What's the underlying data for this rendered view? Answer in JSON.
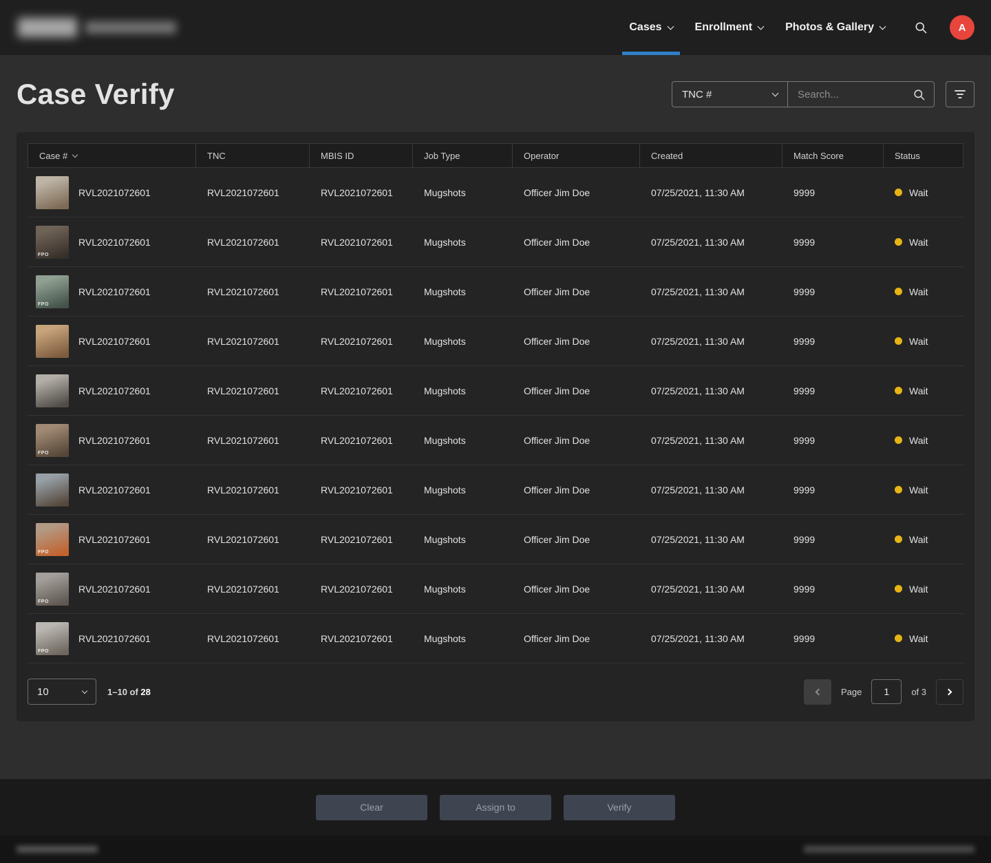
{
  "colors": {
    "accent": "#2f80c9",
    "avatar": "#e8453c",
    "status_wait": "#e7b416"
  },
  "nav": {
    "items": [
      "Cases",
      "Enrollment",
      "Photos & Gallery"
    ],
    "active_item": "Cases",
    "avatar_initial": "A"
  },
  "page": {
    "title": "Case Verify"
  },
  "filters": {
    "category": "TNC #",
    "search_placeholder": "Search..."
  },
  "table": {
    "columns": [
      "Case #",
      "TNC",
      "MBIS ID",
      "Job Type",
      "Operator",
      "Created",
      "Match Score",
      "Status"
    ],
    "fpo_label": "FPO",
    "rows": [
      {
        "case": "RVL2021072601",
        "tnc": "RVL2021072601",
        "mbis": "RVL2021072601",
        "job": "Mugshots",
        "operator": "Officer Jim Doe",
        "created": "07/25/2021, 11:30 AM",
        "score": "9999",
        "status": "Wait",
        "thumb": {
          "from": "#bdb4a6",
          "to": "#7e6a55",
          "fpo": false
        }
      },
      {
        "case": "RVL2021072601",
        "tnc": "RVL2021072601",
        "mbis": "RVL2021072601",
        "job": "Mugshots",
        "operator": "Officer Jim Doe",
        "created": "07/25/2021, 11:30 AM",
        "score": "9999",
        "status": "Wait",
        "thumb": {
          "from": "#6f6257",
          "to": "#362f29",
          "fpo": true
        }
      },
      {
        "case": "RVL2021072601",
        "tnc": "RVL2021072601",
        "mbis": "RVL2021072601",
        "job": "Mugshots",
        "operator": "Officer Jim Doe",
        "created": "07/25/2021, 11:30 AM",
        "score": "9999",
        "status": "Wait",
        "thumb": {
          "from": "#8fa092",
          "to": "#44524a",
          "fpo": true
        }
      },
      {
        "case": "RVL2021072601",
        "tnc": "RVL2021072601",
        "mbis": "RVL2021072601",
        "job": "Mugshots",
        "operator": "Officer Jim Doe",
        "created": "07/25/2021, 11:30 AM",
        "score": "9999",
        "status": "Wait",
        "thumb": {
          "from": "#c7a47c",
          "to": "#7d5c3e",
          "fpo": false
        }
      },
      {
        "case": "RVL2021072601",
        "tnc": "RVL2021072601",
        "mbis": "RVL2021072601",
        "job": "Mugshots",
        "operator": "Officer Jim Doe",
        "created": "07/25/2021, 11:30 AM",
        "score": "9999",
        "status": "Wait",
        "thumb": {
          "from": "#b3afa8",
          "to": "#4f4b46",
          "fpo": false
        }
      },
      {
        "case": "RVL2021072601",
        "tnc": "RVL2021072601",
        "mbis": "RVL2021072601",
        "job": "Mugshots",
        "operator": "Officer Jim Doe",
        "created": "07/25/2021, 11:30 AM",
        "score": "9999",
        "status": "Wait",
        "thumb": {
          "from": "#a08a74",
          "to": "#564738",
          "fpo": true
        }
      },
      {
        "case": "RVL2021072601",
        "tnc": "RVL2021072601",
        "mbis": "RVL2021072601",
        "job": "Mugshots",
        "operator": "Officer Jim Doe",
        "created": "07/25/2021, 11:30 AM",
        "score": "9999",
        "status": "Wait",
        "thumb": {
          "from": "#97a0a6",
          "to": "#55483c",
          "fpo": false
        }
      },
      {
        "case": "RVL2021072601",
        "tnc": "RVL2021072601",
        "mbis": "RVL2021072601",
        "job": "Mugshots",
        "operator": "Officer Jim Doe",
        "created": "07/25/2021, 11:30 AM",
        "score": "9999",
        "status": "Wait",
        "thumb": {
          "from": "#b29a85",
          "to": "#c2622e",
          "fpo": true
        }
      },
      {
        "case": "RVL2021072601",
        "tnc": "RVL2021072601",
        "mbis": "RVL2021072601",
        "job": "Mugshots",
        "operator": "Officer Jim Doe",
        "created": "07/25/2021, 11:30 AM",
        "score": "9999",
        "status": "Wait",
        "thumb": {
          "from": "#a39f9a",
          "to": "#5f5852",
          "fpo": true
        }
      },
      {
        "case": "RVL2021072601",
        "tnc": "RVL2021072601",
        "mbis": "RVL2021072601",
        "job": "Mugshots",
        "operator": "Officer Jim Doe",
        "created": "07/25/2021, 11:30 AM",
        "score": "9999",
        "status": "Wait",
        "thumb": {
          "from": "#bab7b2",
          "to": "#6e675f",
          "fpo": true
        }
      }
    ]
  },
  "pagination": {
    "page_size": "10",
    "range_label": "1–10 of ",
    "total_label": "28",
    "page_label": "Page",
    "current_page": "1",
    "of_total": "of 3"
  },
  "actions": {
    "clear": "Clear",
    "assign": "Assign to",
    "verify": "Verify"
  }
}
